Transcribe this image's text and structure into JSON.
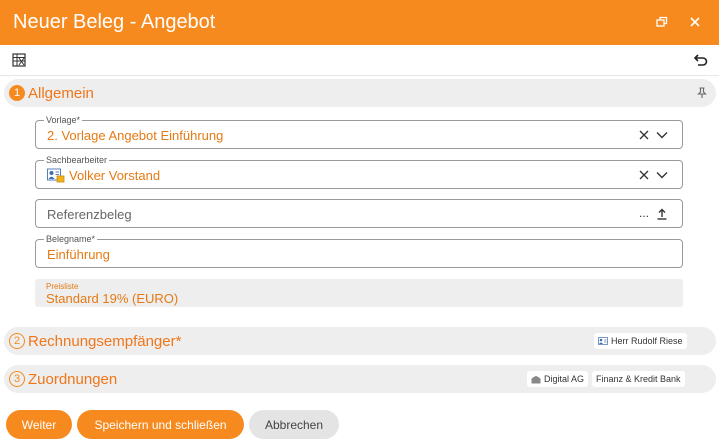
{
  "window": {
    "title": "Neuer Beleg - Angebot"
  },
  "sections": {
    "allgemein": {
      "number": "1",
      "title": "Allgemein"
    },
    "rechnungsempfaenger": {
      "number": "2",
      "title": "Rechnungsempfänger*",
      "chip": "Herr Rudolf Riese"
    },
    "zuordnungen": {
      "number": "3",
      "title": "Zuordnungen",
      "chip_company": "Digital AG",
      "chip_bank": "Finanz & Kredit Bank"
    }
  },
  "fields": {
    "vorlage": {
      "label": "Vorlage*",
      "value": "2. Vorlage Angebot Einführung"
    },
    "sachbearbeiter": {
      "label": "Sachbearbeiter",
      "value": "Volker Vorstand"
    },
    "referenzbeleg": {
      "placeholder": "Referenzbeleg",
      "dots": "..."
    },
    "belegname": {
      "label": "Belegname*",
      "value": "Einführung"
    },
    "preisliste": {
      "label": "Preisliste",
      "value": "Standard 19% (EURO)"
    }
  },
  "buttons": {
    "weiter": "Weiter",
    "save_close": "Speichern und schließen",
    "cancel": "Abbrechen"
  },
  "icons": {
    "restore": "restore-window-icon",
    "close": "close-icon",
    "spreadsheet": "spreadsheet-icon",
    "undo": "undo-icon",
    "pin": "pin-icon",
    "clear": "clear-icon",
    "chevron": "chevron-down-icon",
    "contact": "contact-card-icon",
    "upload": "upload-icon",
    "company": "company-icon"
  },
  "colors": {
    "accent": "#f78a1e",
    "text_accent": "#e57a14",
    "section_bg": "#eeeeee"
  }
}
